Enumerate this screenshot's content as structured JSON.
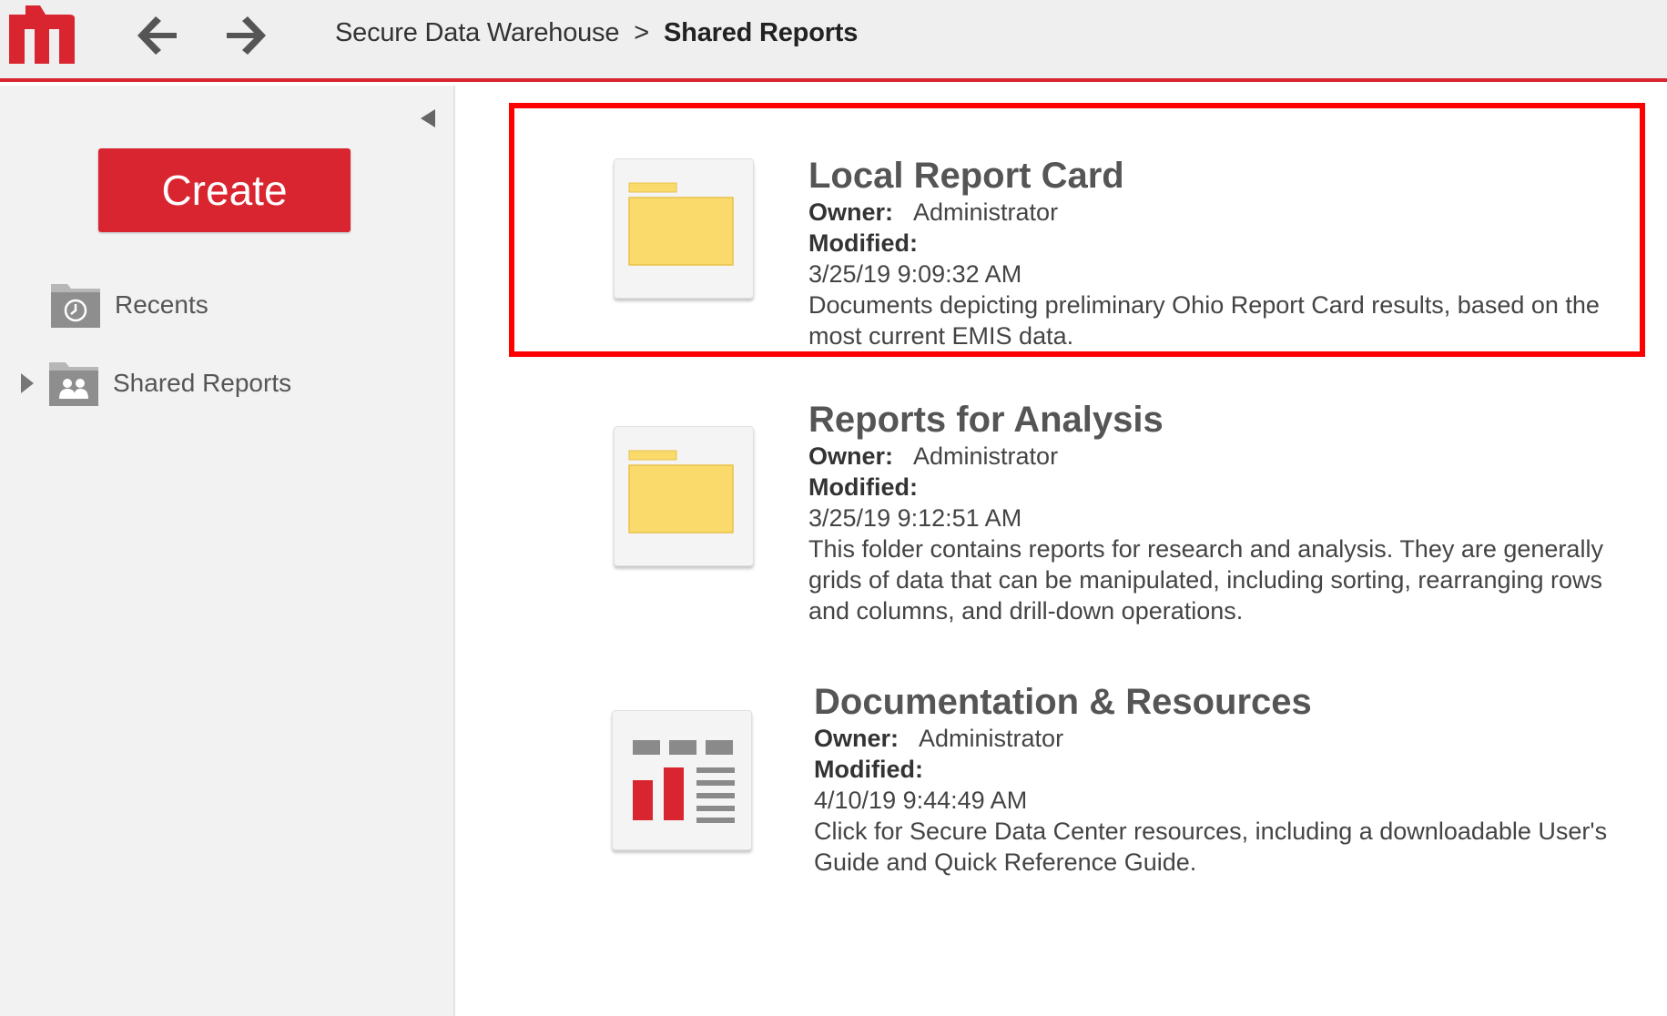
{
  "app": {
    "logo_letter": "m",
    "brand_color": "#d9252f"
  },
  "nav": {
    "back_icon": "arrow-left-icon",
    "forward_icon": "arrow-right-icon"
  },
  "breadcrumb": {
    "parent": "Secure Data Warehouse",
    "separator": ">",
    "current": "Shared Reports"
  },
  "sidebar": {
    "collapse_icon": "triangle-left-icon",
    "create_label": "Create",
    "items": [
      {
        "label": "Recents",
        "icon": "clock-folder-icon"
      },
      {
        "label": "Shared Reports",
        "icon": "shared-folder-icon",
        "expander": "triangle-right-icon"
      }
    ]
  },
  "items": [
    {
      "title": "Local Report Card",
      "owner_label": "Owner:",
      "owner": "Administrator",
      "modified_label": "Modified:",
      "modified": "3/25/19 9:09:32 AM",
      "description": "Documents depicting preliminary Ohio Report Card results, based on the most current EMIS data.",
      "icon": "folder-icon",
      "highlighted": true
    },
    {
      "title": "Reports for Analysis",
      "owner_label": "Owner:",
      "owner": "Administrator",
      "modified_label": "Modified:",
      "modified": "3/25/19 9:12:51 AM",
      "description": "This folder contains reports for research and analysis.  They are generally grids of data that can be manipulated, including sorting, rearranging rows and columns, and drill-down operations.",
      "icon": "folder-icon",
      "highlighted": false
    },
    {
      "title": "Documentation & Resources",
      "owner_label": "Owner:",
      "owner": "Administrator",
      "modified_label": "Modified:",
      "modified": "4/10/19 9:44:49 AM",
      "description": "Click for Secure Data Center resources, including a downloadable User's Guide and Quick Reference Guide.",
      "icon": "dashboard-icon",
      "highlighted": false
    }
  ],
  "colors": {
    "accent": "#d9252f",
    "highlight": "#ff0000",
    "folder_fill": "#f9da6b",
    "folder_stroke": "#e8c24a"
  }
}
